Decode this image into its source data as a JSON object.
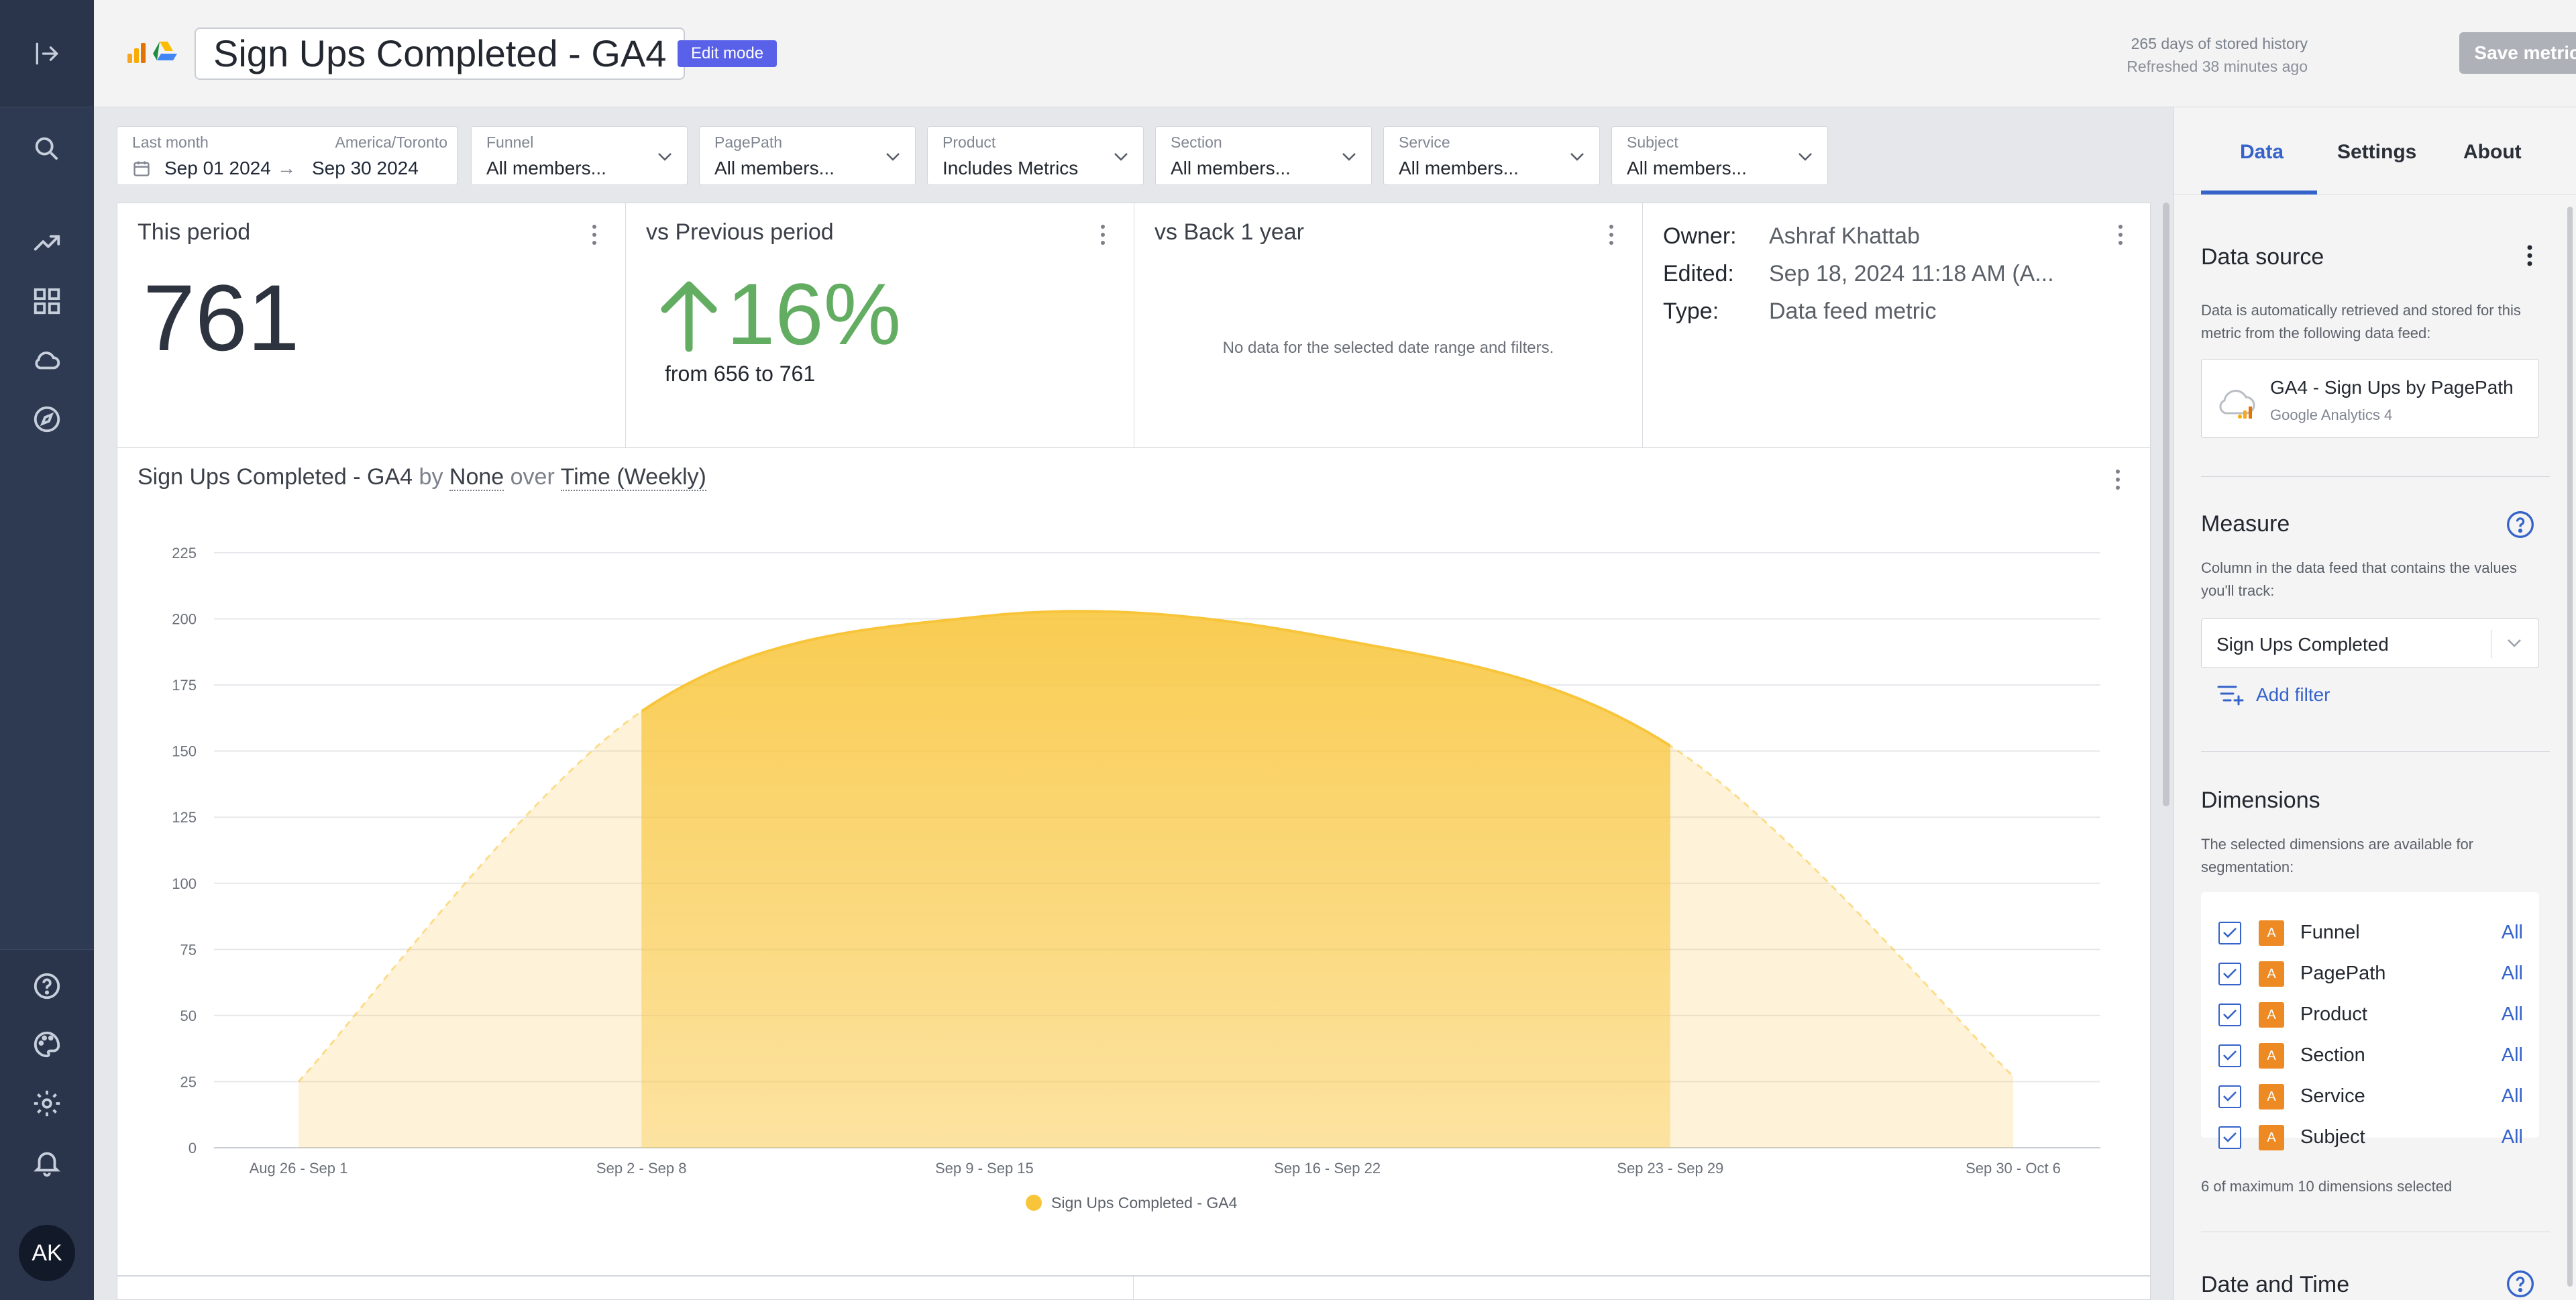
{
  "header": {
    "title": "Sign Ups Completed - GA4",
    "mode_badge": "Edit mode",
    "history": "265 days of stored history",
    "refreshed": "Refreshed 38 minutes ago",
    "save_label": "Save metric"
  },
  "nav": {
    "avatar_initials": "AK",
    "icons": [
      "collapse-icon",
      "search-icon",
      "trend-icon",
      "dashboard-icon",
      "cloud-icon",
      "compass-icon",
      "help-icon",
      "palette-icon",
      "gear-icon",
      "bell-icon"
    ]
  },
  "filters": {
    "date": {
      "label": "Last month",
      "timezone": "America/Toronto",
      "start": "Sep 01 2024",
      "arrow": "→",
      "end": "Sep 30 2024"
    },
    "items": [
      {
        "label": "Funnel",
        "value": "All members..."
      },
      {
        "label": "PagePath",
        "value": "All members..."
      },
      {
        "label": "Product",
        "value": "Includes Metrics"
      },
      {
        "label": "Section",
        "value": "All members..."
      },
      {
        "label": "Service",
        "value": "All members..."
      },
      {
        "label": "Subject",
        "value": "All members..."
      }
    ]
  },
  "cards": {
    "this_period": {
      "title": "This period",
      "value": "761"
    },
    "prev_period": {
      "title": "vs Previous period",
      "pct": "16%",
      "detail": "from 656 to 761",
      "color": "#63ad62"
    },
    "back_year": {
      "title": "vs Back 1 year",
      "message": "No data for the selected date range and filters."
    },
    "info": {
      "owner_label": "Owner:",
      "owner": "Ashraf Khattab",
      "edited_label": "Edited:",
      "edited": "Sep 18, 2024 11:18 AM (A...",
      "type_label": "Type:",
      "type": "Data feed metric"
    }
  },
  "chart": {
    "title_main": "Sign Ups Completed - GA4",
    "by_word": "by",
    "by_value": "None",
    "over_word": "over",
    "over_value": "Time (Weekly)",
    "legend": "Sign Ups Completed - GA4"
  },
  "chart_data": {
    "type": "area",
    "title": "Sign Ups Completed - GA4",
    "categories": [
      "Aug 26 - Sep 1",
      "Sep 2 - Sep 8",
      "Sep 9 - Sep 15",
      "Sep 16 - Sep 22",
      "Sep 23 - Sep 29",
      "Sep 30 - Oct 6"
    ],
    "series": [
      {
        "name": "Sign Ups Completed - GA4",
        "values": [
          25,
          165,
          201,
          193,
          152,
          27
        ],
        "color": "#f8c53a"
      }
    ],
    "selected_range": [
      "Sep 2 - Sep 8",
      "Sep 23 - Sep 29"
    ],
    "yticks": [
      0,
      25,
      50,
      75,
      100,
      125,
      150,
      175,
      200,
      225
    ],
    "ylim": [
      0,
      225
    ],
    "grid": true,
    "legend_position": "bottom"
  },
  "panel": {
    "tabs": [
      "Data",
      "Settings",
      "About"
    ],
    "active_tab": "Data",
    "data_source": {
      "heading": "Data source",
      "desc": "Data is automatically retrieved and stored for this metric from the following data feed:",
      "feed_name": "GA4 - Sign Ups by PagePath",
      "feed_source": "Google Analytics 4"
    },
    "measure": {
      "heading": "Measure",
      "desc": "Column in the data feed that contains the values you'll track:",
      "value": "Sign Ups Completed",
      "add_filter": "Add filter"
    },
    "dimensions": {
      "heading": "Dimensions",
      "desc": "The selected dimensions are available for segmentation:",
      "tag": "A",
      "all_label": "All",
      "items": [
        "Funnel",
        "PagePath",
        "Product",
        "Section",
        "Service",
        "Subject"
      ],
      "summary": "6 of maximum 10 dimensions selected"
    },
    "datetime": {
      "heading": "Date and Time"
    }
  }
}
